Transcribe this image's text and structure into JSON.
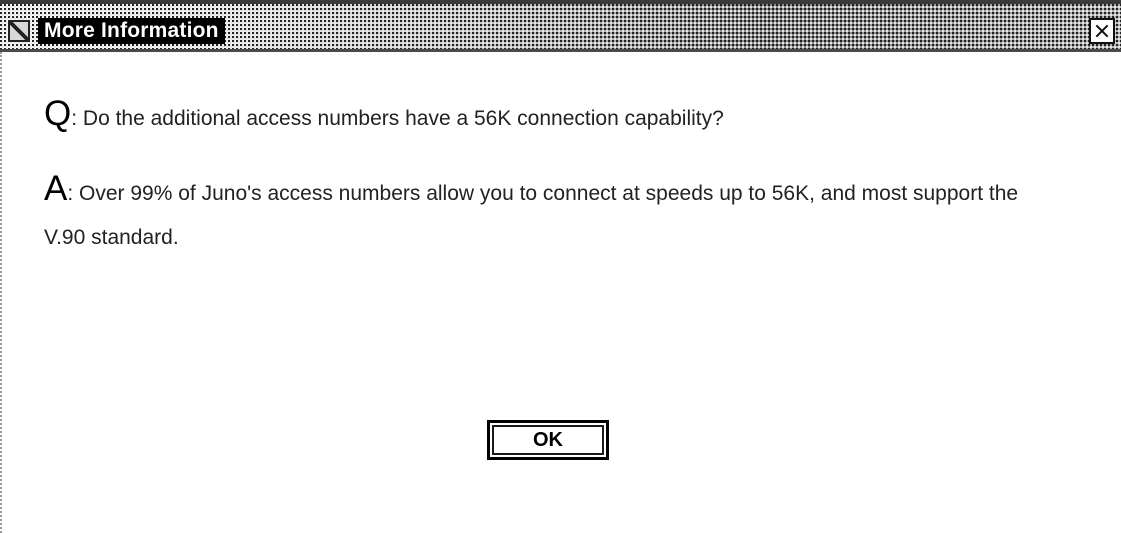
{
  "window": {
    "title": "More Information"
  },
  "question": {
    "letter": "Q",
    "text": ": Do the additional access numbers have a 56K connection capability?"
  },
  "answer": {
    "letter": "A",
    "text": ": Over 99% of Juno's access numbers allow you to connect at speeds up to 56K, and most support the V.90 standard."
  },
  "buttons": {
    "ok_label": "OK"
  },
  "icons": {
    "title": "app-window-icon",
    "close": "close-icon"
  },
  "colors": {
    "background": "#ffffff",
    "title_text_background": "#000000",
    "title_text": "#ffffff",
    "text": "#222222"
  }
}
